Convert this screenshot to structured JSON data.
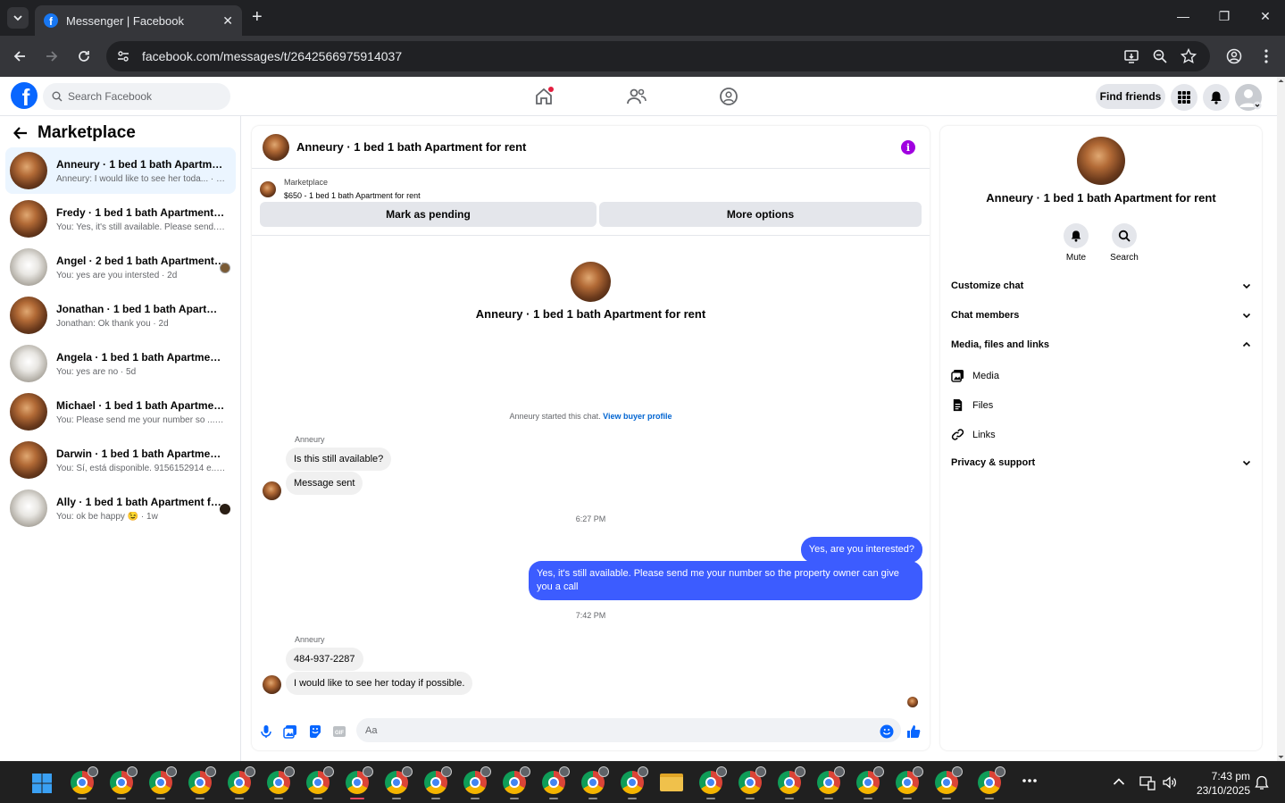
{
  "browser": {
    "tab_title": "Messenger | Facebook",
    "url": "facebook.com/messages/t/2642566975914037"
  },
  "fb": {
    "search_placeholder": "Search Facebook",
    "find_friends": "Find friends"
  },
  "left": {
    "header": "Marketplace",
    "conversations": [
      {
        "name": "Anneury · 1 bed 1 bath Apartment for rent",
        "preview": "Anneury: I would like to see her toda... · 1m",
        "active": true
      },
      {
        "name": "Fredy · 1 bed 1 bath Apartment for rent",
        "preview": "You: Yes, it's still available. Please send... · 1h"
      },
      {
        "name": "Angel · 2 bed 1 bath Apartment for rent",
        "preview": "You: yes are you intersted · 2d"
      },
      {
        "name": "Jonathan · 1 bed 1 bath Apartment for rent",
        "preview": "Jonathan: Ok thank you · 2d"
      },
      {
        "name": "Angela · 1 bed 1 bath Apartment for rent",
        "preview": "You: yes are no · 5d"
      },
      {
        "name": "Michael · 1 bed 1 bath Apartment for rent",
        "preview": "You: Please send me your number so ... · 6d"
      },
      {
        "name": "Darwin · 1 bed 1 bath Apartment for rent",
        "preview": "You: Sí, está disponible. 9156152914 e... · 1w"
      },
      {
        "name": "Ally · 1 bed 1 bath Apartment for rent",
        "preview": "You: ok be happy 😉 · 1w"
      }
    ]
  },
  "chat": {
    "title": "Anneury · 1 bed 1 bath Apartment for rent",
    "marketplace_label": "Marketplace",
    "listing": "$650 - 1 bed 1 bath Apartment for rent",
    "mark_pending": "Mark as pending",
    "more_options": "More options",
    "intro_name": "Anneury · 1 bed 1 bath Apartment for rent",
    "system_msg": "Anneury started this chat.",
    "view_buyer": "View buyer profile",
    "sender1": "Anneury",
    "msg1": "Is this still available?",
    "msg2": "Message sent",
    "time1": "6:27 PM",
    "out1": "Yes, are you interested?",
    "out2": "Yes, it's still available. Please send me your number so the property owner can give you a call",
    "time2": "7:42 PM",
    "sender2": "Anneury",
    "msg3": "484-937-2287",
    "msg4": "I would like to see her today if possible.",
    "composer_placeholder": "Aa"
  },
  "right": {
    "name": "Anneury · 1 bed 1 bath Apartment for rent",
    "mute": "Mute",
    "search": "Search",
    "customize": "Customize chat",
    "members": "Chat members",
    "media_files_links": "Media, files and links",
    "media": "Media",
    "files": "Files",
    "links": "Links",
    "privacy": "Privacy & support"
  },
  "taskbar": {
    "time": "7:43 pm",
    "date": "23/10/2025"
  },
  "colors": {
    "brand": "#0866ff",
    "outgoing_bubble": "#3c5cff",
    "active_conv": "#ebf5ff"
  }
}
